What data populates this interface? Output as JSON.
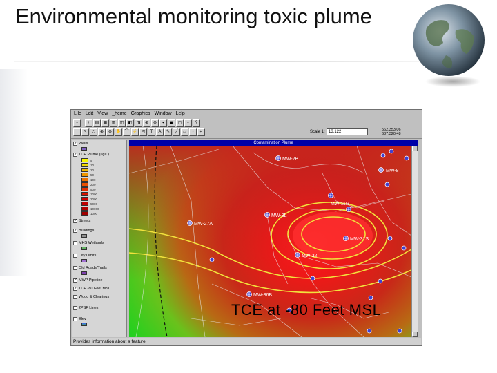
{
  "slide": {
    "title": "Environmental monitoring toxic plume"
  },
  "app": {
    "menu": [
      "Lile",
      "Ldit",
      "View",
      "_heme",
      "Graphics",
      "Window",
      "Lelp"
    ],
    "scale_label": "Scale 1:",
    "scale_value": "13,122",
    "coords": [
      "562,353.06",
      "687,320.48"
    ],
    "map_title": "Contamination Plume",
    "status_text": "Provides information about a feature",
    "caption": "TCE  at  -80  Feet  MSL",
    "legend": {
      "wells": "Wells",
      "plume": "TCE Plume (ug/L)",
      "streets": "Streets",
      "buildings": "Buildings",
      "wetlands": "MHS Wetlands",
      "city_limits": "City Limits",
      "old_roads": "Old Roads/Trails",
      "pipelines": "MWP Pipeline",
      "tce_layer": "TCE -80 Feet MSL",
      "landcover": "Wood & Clearings",
      "property": "2PSF Lines",
      "elevation": "Elev"
    },
    "ramp_values": [
      "5",
      "10",
      "20",
      "50",
      "100",
      "200",
      "500",
      "1000",
      "2000",
      "5000",
      "10000",
      "1000"
    ],
    "ramp_colors": [
      "#f7f700",
      "#f0d800",
      "#f0b800",
      "#ee9600",
      "#ec7200",
      "#e85000",
      "#e03000",
      "#d81400",
      "#d00000",
      "#c00000",
      "#b00000",
      "#a00000"
    ],
    "wells": [
      {
        "id": "w1",
        "label": "MW-2B"
      },
      {
        "id": "w2",
        "label": "MW-8"
      },
      {
        "id": "w3",
        "label": "MW-11R"
      },
      {
        "id": "w4",
        "label": "MW-3L"
      },
      {
        "id": "w5",
        "label": "MW-27A"
      },
      {
        "id": "w6",
        "label": "MW-31S"
      },
      {
        "id": "w7",
        "label": "MW-32"
      },
      {
        "id": "w8",
        "label": "MW-36B"
      }
    ],
    "colors": {
      "plume_core": "#ff2020",
      "plume_low": "#1fd11f",
      "contour": "#f2e23c",
      "window_blue": "#0000a8"
    }
  }
}
